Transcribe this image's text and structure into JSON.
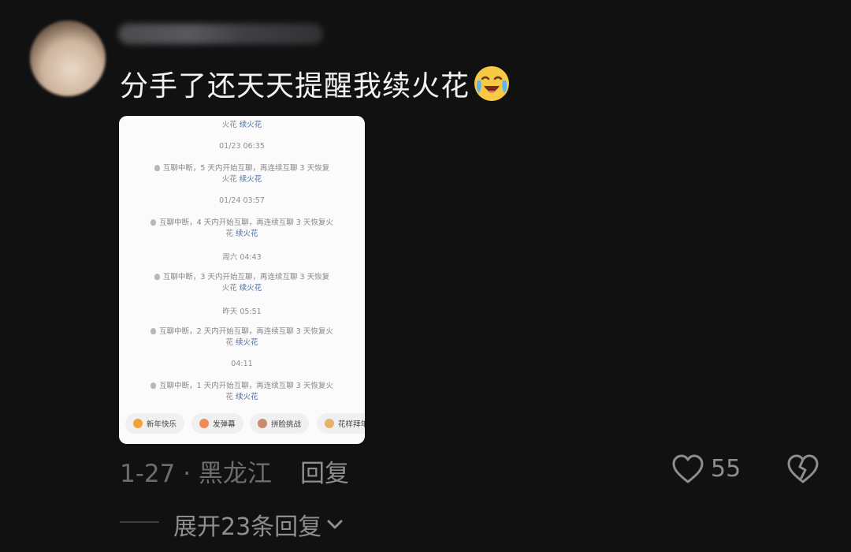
{
  "comment": {
    "username": "",
    "text": "分手了还天天提醒我续火花",
    "emoji": "crying-laughing-emoji",
    "date_location": "1-27 · 黑龙江",
    "reply_label": "回复",
    "likes": "55",
    "expand_label": "展开23条回复"
  },
  "screenshot": {
    "top_fragment": "火花",
    "top_link": "续火花",
    "entries": [
      {
        "time": "01/23 06:35",
        "line1": "互聊中断，5 天内开始互聊，再连续互聊 3 天恢复",
        "line2": "火花",
        "link": "续火花"
      },
      {
        "time": "01/24 03:57",
        "line1": "互聊中断，4 天内开始互聊，再连续互聊 3 天恢复火",
        "line2": "花",
        "link": "续火花"
      },
      {
        "time": "周六 04:43",
        "line1": "互聊中断，3 天内开始互聊，再连续互聊 3 天恢复",
        "line2": "火花",
        "link": "续火花"
      },
      {
        "time": "昨天 05:51",
        "line1": "互聊中断，2 天内开始互聊，再连续互聊 3 天恢复火",
        "line2": "花",
        "link": "续火花"
      },
      {
        "time": "04:11",
        "line1": "互聊中断，1 天内开始互聊，再连续互聊 3 天恢复火",
        "line2": "花",
        "link": "续火花"
      }
    ],
    "chips": [
      "新年快乐",
      "发弹幕",
      "拼脸挑战",
      "花样拜年"
    ]
  },
  "colors": {
    "background": "#111112",
    "link": "#4a6fa8"
  }
}
